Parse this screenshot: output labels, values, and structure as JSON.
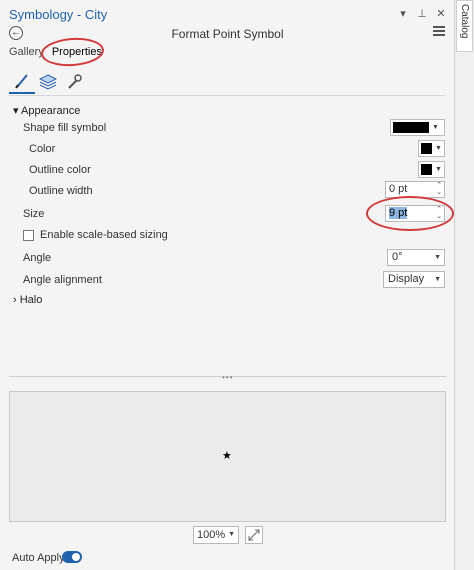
{
  "window": {
    "title": "Symbology - City",
    "header": "Format Point Symbol",
    "controls": [
      "▾",
      "⊥",
      "✕"
    ]
  },
  "tabs": [
    {
      "label": "Gallery"
    },
    {
      "label": "Properties"
    }
  ],
  "sub_tabs": [
    "brush-icon",
    "layers-icon",
    "wrench-icon"
  ],
  "appearance": {
    "label": "Appearance",
    "shape_fill_label": "Shape fill symbol",
    "color_label": "Color",
    "outline_color_label": "Outline color",
    "outline_width_label": "Outline width",
    "outline_width_value": "0 pt",
    "size_label": "Size",
    "size_value": "9 pt",
    "scale_sizing_label": "Enable scale-based sizing",
    "angle_label": "Angle",
    "angle_value": "0°",
    "angle_alignment_label": "Angle alignment",
    "angle_alignment_value": "Display"
  },
  "halo": {
    "label": "Halo"
  },
  "preview": {
    "symbol": "★"
  },
  "footer": {
    "zoom_value": "100%",
    "auto_apply_label": "Auto Apply",
    "auto_apply_on": true
  },
  "side": {
    "catalog_label": "Catalog"
  },
  "colors": {
    "accent": "#1f63b0",
    "annotation": "#d23a3a",
    "fill_swatch": "#000000"
  }
}
